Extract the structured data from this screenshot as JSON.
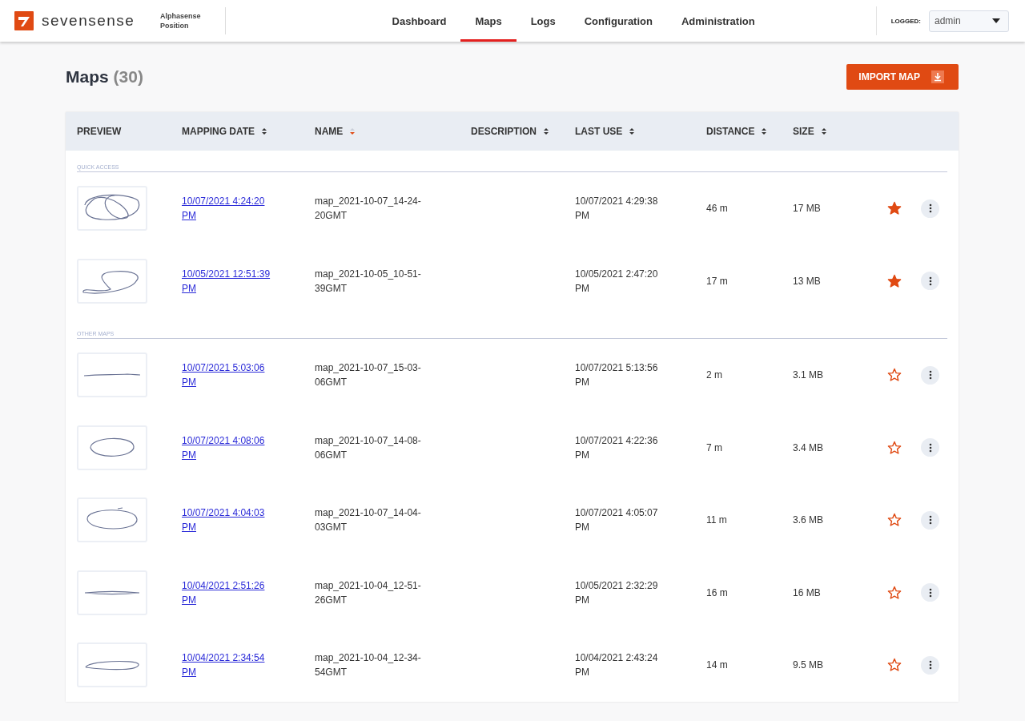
{
  "header": {
    "brand": "sevensense",
    "product": "Alphasense\nPosition",
    "nav": [
      {
        "label": "Dashboard",
        "selected": false
      },
      {
        "label": "Maps",
        "selected": true
      },
      {
        "label": "Logs",
        "selected": false
      },
      {
        "label": "Configuration",
        "selected": false
      },
      {
        "label": "Administration",
        "selected": false
      }
    ],
    "logged_label": "LOGGED:",
    "user": "admin"
  },
  "page": {
    "title": "Maps",
    "count": "(30)",
    "import_button": "IMPORT MAP"
  },
  "table": {
    "columns": [
      {
        "label": "PREVIEW",
        "sortable": false
      },
      {
        "label": "MAPPING DATE",
        "sortable": true,
        "sorted": false
      },
      {
        "label": "NAME",
        "sortable": true,
        "sorted": true
      },
      {
        "label": "DESCRIPTION",
        "sortable": true,
        "sorted": false
      },
      {
        "label": "LAST USE",
        "sortable": true,
        "sorted": false
      },
      {
        "label": "DISTANCE",
        "sortable": true,
        "sorted": false
      },
      {
        "label": "SIZE",
        "sortable": true,
        "sorted": false
      }
    ],
    "sections": [
      {
        "title": "QUICK ACCESS",
        "rows": [
          {
            "mapping_date": "10/07/2021 4:24:20 PM",
            "name": "map_2021-10-07_14-24-20GMT",
            "last_use": "10/07/2021 4:29:38 PM",
            "distance": "46 m",
            "size": "17 MB",
            "favorite": true
          },
          {
            "mapping_date": "10/05/2021 12:51:39 PM",
            "name": "map_2021-10-05_10-51-39GMT",
            "last_use": "10/05/2021 2:47:20 PM",
            "distance": "17 m",
            "size": "13 MB",
            "favorite": true
          }
        ]
      },
      {
        "title": "OTHER MAPS",
        "rows": [
          {
            "mapping_date": "10/07/2021 5:03:06 PM",
            "name": "map_2021-10-07_15-03-06GMT",
            "last_use": "10/07/2021 5:13:56 PM",
            "distance": "2 m",
            "size": "3.1 MB",
            "favorite": false
          },
          {
            "mapping_date": "10/07/2021 4:08:06 PM",
            "name": "map_2021-10-07_14-08-06GMT",
            "last_use": "10/07/2021 4:22:36 PM",
            "distance": "7 m",
            "size": "3.4 MB",
            "favorite": false
          },
          {
            "mapping_date": "10/07/2021 4:04:03 PM",
            "name": "map_2021-10-07_14-04-03GMT",
            "last_use": "10/07/2021 4:05:07 PM",
            "distance": "11 m",
            "size": "3.6 MB",
            "favorite": false
          },
          {
            "mapping_date": "10/04/2021 2:51:26 PM",
            "name": "map_2021-10-04_12-51-26GMT",
            "last_use": "10/05/2021 2:32:29 PM",
            "distance": "16 m",
            "size": "16 MB",
            "favorite": false
          },
          {
            "mapping_date": "10/04/2021 2:34:54 PM",
            "name": "map_2021-10-04_12-34-54GMT",
            "last_use": "10/04/2021 2:43:24 PM",
            "distance": "14 m",
            "size": "9.5 MB",
            "favorite": false
          }
        ]
      }
    ]
  }
}
